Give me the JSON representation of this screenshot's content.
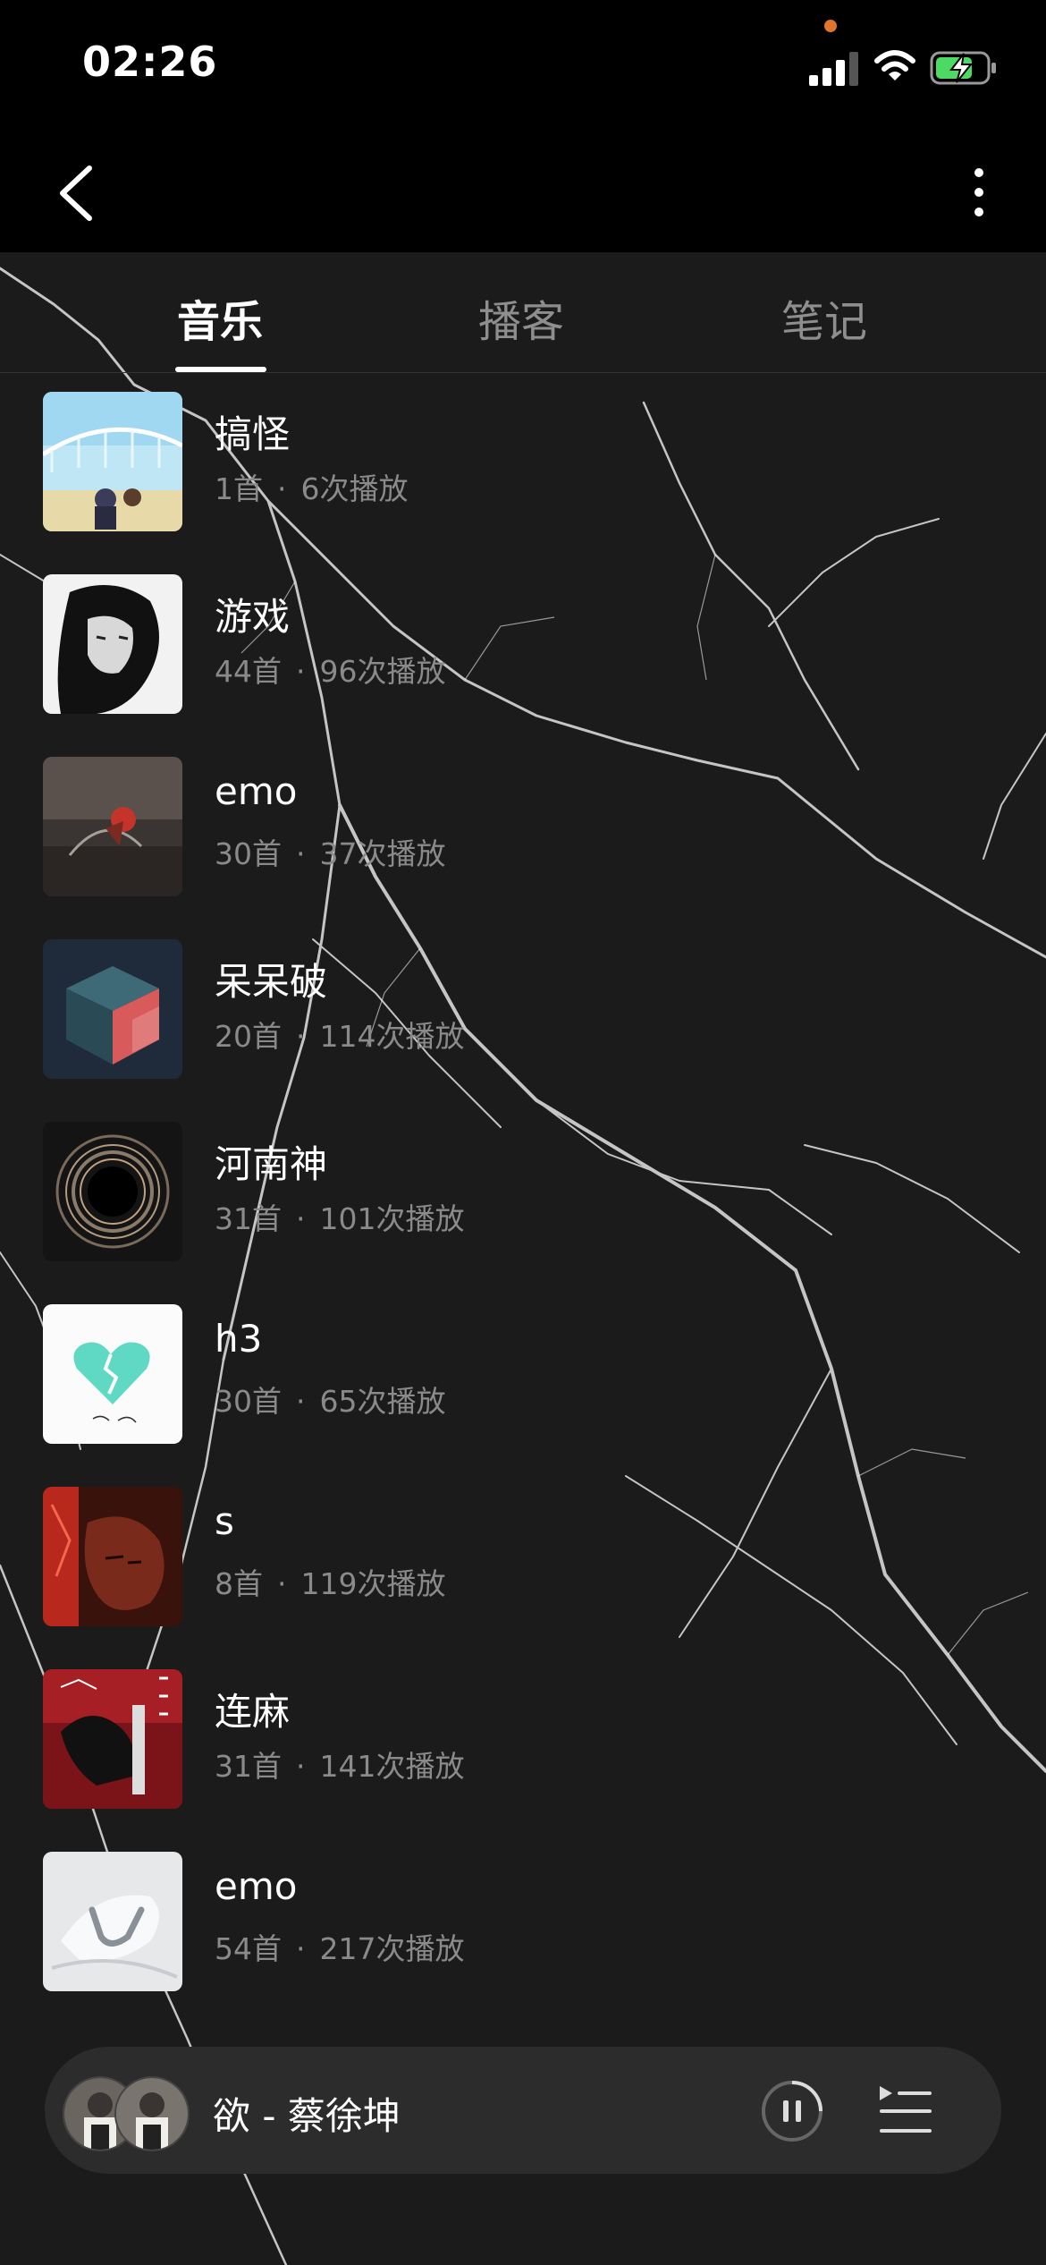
{
  "status_bar": {
    "time": "02:26",
    "icons": [
      "signal-icon",
      "wifi-icon",
      "battery-charging-icon"
    ],
    "indicator_color": "#e0762d",
    "battery_color": "#4cd964"
  },
  "nav_bar": {
    "back_icon": "chevron-left-icon",
    "more_icon": "more-vertical-icon"
  },
  "tabs": [
    {
      "label": "音乐",
      "active": true
    },
    {
      "label": "播客",
      "active": false
    },
    {
      "label": "笔记",
      "active": false
    }
  ],
  "playlists": [
    {
      "title": "搞怪",
      "songs": "1首",
      "plays": "6次播放",
      "cover": "anime-bridge-cover"
    },
    {
      "title": "游戏",
      "songs": "44首",
      "plays": "96次播放",
      "cover": "portrait-bw-cover"
    },
    {
      "title": "emo",
      "songs": "30首",
      "plays": "37次播放",
      "cover": "beach-flower-cover"
    },
    {
      "title": "呆呆破",
      "songs": "20首",
      "plays": "114次播放",
      "cover": "cube-cover"
    },
    {
      "title": "河南神",
      "songs": "31首",
      "plays": "101次播放",
      "cover": "swirl-cover"
    },
    {
      "title": "h3",
      "songs": "30首",
      "plays": "65次播放",
      "cover": "broken-heart-cover"
    },
    {
      "title": "s",
      "songs": "8首",
      "plays": "119次播放",
      "cover": "red-portrait-cover"
    },
    {
      "title": "连麻",
      "songs": "31首",
      "plays": "141次播放",
      "cover": "manga-red-cover"
    },
    {
      "title": "emo",
      "songs": "54首",
      "plays": "217次播放",
      "cover": "white-abstract-cover"
    }
  ],
  "separator": "·",
  "mini_player": {
    "title": "欲 - 蔡徐坤",
    "pause_icon": "pause-circle-icon",
    "queue_icon": "playlist-queue-icon"
  }
}
